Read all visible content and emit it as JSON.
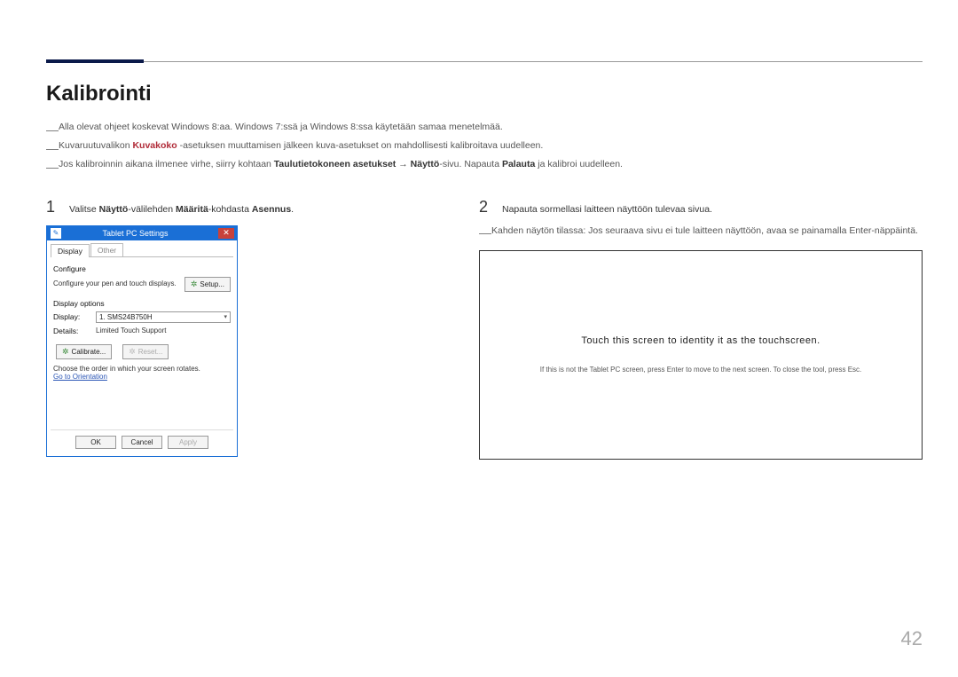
{
  "page": {
    "title": "Kalibrointi",
    "number": "42"
  },
  "intro": {
    "line1": "Alla olevat ohjeet koskevat Windows 8:aa. Windows 7:ssä ja Windows 8:ssa käytetään samaa menetelmää.",
    "line2_pre": "Kuvaruutuvalikon ",
    "line2_accent": "Kuvakoko",
    "line2_post": " -asetuksen muuttamisen jälkeen kuva-asetukset on mahdollisesti kalibroitava uudelleen.",
    "line3_a": "Jos kalibroinnin aikana ilmenee virhe, siirry kohtaan ",
    "line3_b": "Taulutietokoneen asetukset",
    "line3_arrow": " → ",
    "line3_c": "Näyttö",
    "line3_d": "-sivu. Napauta ",
    "line3_e": "Palauta",
    "line3_f": " ja kalibroi uudelleen."
  },
  "step1": {
    "num": "1",
    "a": "Valitse ",
    "b": "Näyttö",
    "c": "-välilehden ",
    "d": "Määritä",
    "e": "-kohdasta ",
    "f": "Asennus",
    "g": "."
  },
  "dialog": {
    "title": "Tablet PC Settings",
    "tabs": {
      "display": "Display",
      "other": "Other"
    },
    "configure": "Configure",
    "configure_desc": "Configure your pen and touch displays.",
    "setup_btn": "Setup...",
    "display_options": "Display options",
    "display_lbl": "Display:",
    "display_val": "1. SMS24B750H",
    "details_lbl": "Details:",
    "details_val": "Limited Touch Support",
    "calibrate_btn": "Calibrate...",
    "reset_btn": "Reset...",
    "rotate_note": "Choose the order in which your screen rotates.",
    "orientation_link": "Go to Orientation",
    "ok": "OK",
    "cancel": "Cancel",
    "apply": "Apply"
  },
  "step2": {
    "num": "2",
    "text": "Napauta sormellasi laitteen näyttöön tulevaa sivua.",
    "sub": "Kahden näytön tilassa: Jos seuraava sivu ei tule laitteen näyttöön, avaa se painamalla Enter-näppäintä."
  },
  "touch": {
    "main": "Touch this screen to identity it as the touchscreen.",
    "sub": "If this is not the Tablet PC screen, press Enter to move to the next screen. To close the tool, press Esc."
  }
}
